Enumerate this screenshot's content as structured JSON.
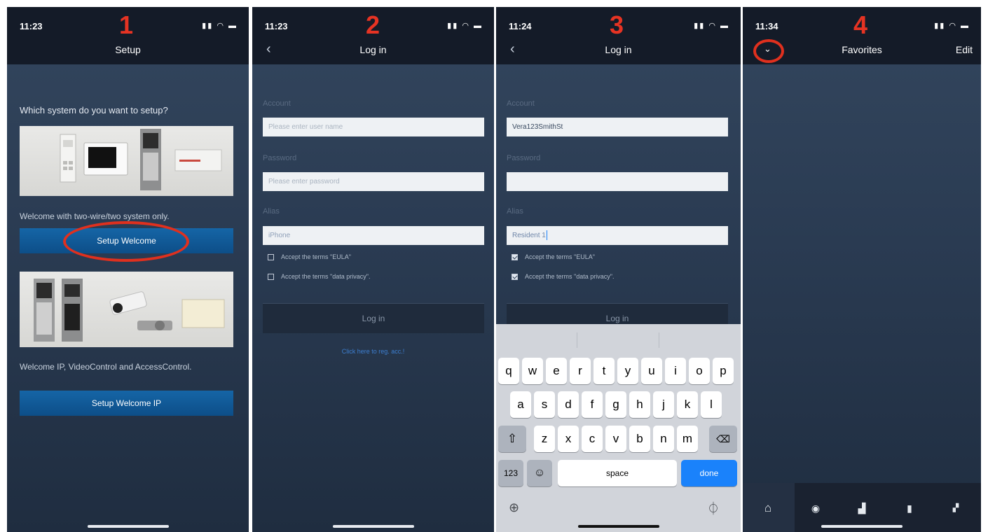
{
  "screen1": {
    "time": "11:23",
    "step": "1",
    "title": "Setup",
    "question": "Which system do you want to setup?",
    "caption1": "Welcome with two-wire/two system only.",
    "button1": "Setup Welcome",
    "caption2": "Welcome IP, VideoControl and AccessControl.",
    "button2": "Setup Welcome IP"
  },
  "screen2": {
    "time": "11:23",
    "step": "2",
    "title": "Log in",
    "account_label": "Account",
    "account_placeholder": "Please enter user name",
    "password_label": "Password",
    "password_placeholder": "Please enter password",
    "alias_label": "Alias",
    "alias_value": "iPhone",
    "eula_label": "Accept the terms \"EULA\"",
    "privacy_label": "Accept the terms \"data privacy\".",
    "login_label": "Log in",
    "register_link": "Click here to reg. acc.!"
  },
  "screen3": {
    "time": "11:24",
    "step": "3",
    "title": "Log in",
    "account_label": "Account",
    "account_value": "Vera123SmithSt",
    "password_label": "Password",
    "alias_label": "Alias",
    "alias_value": "Resident 1",
    "eula_label": "Accept the terms \"EULA\"",
    "privacy_label": "Accept the terms \"data privacy\".",
    "login_label": "Log in",
    "keyboard": {
      "row1": [
        "q",
        "w",
        "e",
        "r",
        "t",
        "y",
        "u",
        "i",
        "o",
        "p"
      ],
      "row2": [
        "a",
        "s",
        "d",
        "f",
        "g",
        "h",
        "j",
        "k",
        "l"
      ],
      "row3": [
        "z",
        "x",
        "c",
        "v",
        "b",
        "n",
        "m"
      ],
      "numbers": "123",
      "space": "space",
      "done": "done"
    }
  },
  "screen4": {
    "time": "11:34",
    "step": "4",
    "title": "Favorites",
    "edit_label": "Edit"
  },
  "colors": {
    "accent_red": "#e0301e",
    "button_blue": "#1565a6",
    "keyboard_done": "#1a82fb"
  }
}
